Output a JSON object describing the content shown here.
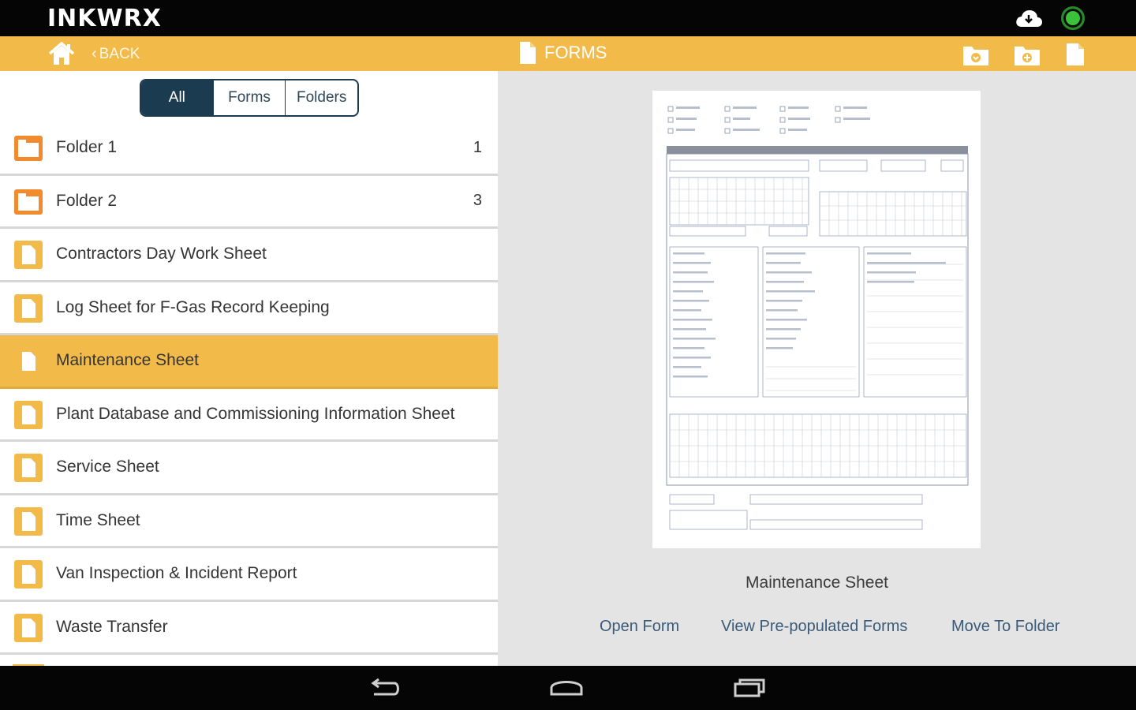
{
  "app": {
    "logo_text": "INKWRX",
    "status_color": "#39c23a"
  },
  "actionbar": {
    "back_label": "BACK",
    "title": "FORMS",
    "accent_color": "#f2bb49",
    "icons": [
      "home-icon",
      "folder-download-icon",
      "folder-add-icon",
      "new-document-icon"
    ]
  },
  "filter": {
    "tabs": [
      {
        "label": "All",
        "active": true
      },
      {
        "label": "Forms",
        "active": false
      },
      {
        "label": "Folders",
        "active": false
      }
    ]
  },
  "list": {
    "items": [
      {
        "type": "folder",
        "label": "Folder 1",
        "count": "1"
      },
      {
        "type": "folder",
        "label": "Folder 2",
        "count": "3"
      },
      {
        "type": "form",
        "label": "Contractors Day Work Sheet",
        "count": ""
      },
      {
        "type": "form",
        "label": "Log Sheet for F-Gas Record Keeping",
        "count": ""
      },
      {
        "type": "form",
        "label": "Maintenance Sheet",
        "count": "",
        "selected": true
      },
      {
        "type": "form",
        "label": "Plant Database and Commissioning Information Sheet",
        "count": ""
      },
      {
        "type": "form",
        "label": "Service Sheet",
        "count": ""
      },
      {
        "type": "form",
        "label": "Time Sheet",
        "count": ""
      },
      {
        "type": "form",
        "label": "Van Inspection & Incident Report",
        "count": ""
      },
      {
        "type": "form",
        "label": "Waste Transfer",
        "count": ""
      }
    ]
  },
  "detail": {
    "form_name": "Maintenance Sheet",
    "actions": {
      "open": "Open Form",
      "view_prepopulated": "View Pre-populated Forms",
      "move": "Move To Folder"
    }
  },
  "navbar": {
    "icons": [
      "back-nav-icon",
      "home-nav-icon",
      "recent-apps-icon"
    ]
  }
}
